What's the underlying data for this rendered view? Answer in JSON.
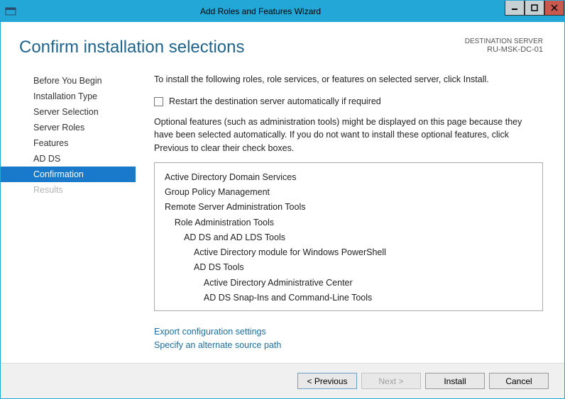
{
  "window": {
    "title": "Add Roles and Features Wizard"
  },
  "page": {
    "title": "Confirm installation selections",
    "dest_label": "DESTINATION SERVER",
    "dest_server": "RU-MSK-DC-01"
  },
  "sidebar": {
    "items": [
      {
        "label": "Before You Begin",
        "state": "normal"
      },
      {
        "label": "Installation Type",
        "state": "normal"
      },
      {
        "label": "Server Selection",
        "state": "normal"
      },
      {
        "label": "Server Roles",
        "state": "normal"
      },
      {
        "label": "Features",
        "state": "normal"
      },
      {
        "label": "AD DS",
        "state": "normal"
      },
      {
        "label": "Confirmation",
        "state": "active"
      },
      {
        "label": "Results",
        "state": "disabled"
      }
    ]
  },
  "main": {
    "intro": "To install the following roles, role services, or features on selected server, click Install.",
    "restart_label": "Restart the destination server automatically if required",
    "optional_text": "Optional features (such as administration tools) might be displayed on this page because they have been selected automatically. If you do not want to install these optional features, click Previous to clear their check boxes.",
    "features": [
      "Active Directory Domain Services",
      "Group Policy Management",
      "Remote Server Administration Tools",
      "    Role Administration Tools",
      "        AD DS and AD LDS Tools",
      "            Active Directory module for Windows PowerShell",
      "            AD DS Tools",
      "                Active Directory Administrative Center",
      "                AD DS Snap-Ins and Command-Line Tools"
    ],
    "link_export": "Export configuration settings",
    "link_altpath": "Specify an alternate source path"
  },
  "buttons": {
    "previous": "< Previous",
    "next": "Next >",
    "install": "Install",
    "cancel": "Cancel"
  }
}
